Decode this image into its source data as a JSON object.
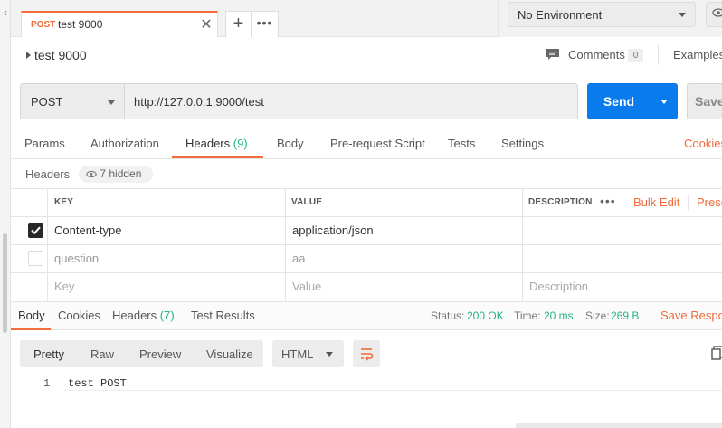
{
  "tabs": {
    "active_method": "POST",
    "active_name": "test 9000",
    "close_glyph": "✕",
    "add_glyph": "+",
    "more_glyph": "•••"
  },
  "environment": {
    "selected": "No Environment"
  },
  "request": {
    "title": "test 9000",
    "comments_label": "Comments",
    "comments_count": "0",
    "examples_label": "Examples",
    "method": "POST",
    "url": "http://127.0.0.1:9000/test",
    "send_label": "Send",
    "save_label": "Save"
  },
  "request_tabs": {
    "params": "Params",
    "authorization": "Authorization",
    "headers": "Headers",
    "headers_count": "(9)",
    "body": "Body",
    "pre_request": "Pre-request Script",
    "tests": "Tests",
    "settings": "Settings",
    "cookies": "Cookies"
  },
  "headers_section": {
    "label": "Headers",
    "hidden_label": "7 hidden",
    "columns": {
      "key": "KEY",
      "value": "VALUE",
      "description": "DESCRIPTION"
    },
    "bulk_edit": "Bulk Edit",
    "presets": "Presets",
    "rows": [
      {
        "key": "Content-type",
        "value": "application/json",
        "enabled": true
      },
      {
        "key": "question",
        "value": "aa",
        "enabled": false
      }
    ],
    "placeholder": {
      "key": "Key",
      "value": "Value",
      "description": "Description"
    }
  },
  "response": {
    "tabs": {
      "body": "Body",
      "cookies": "Cookies",
      "headers": "Headers",
      "headers_count": "(7)",
      "test_results": "Test Results"
    },
    "status_label": "Status:",
    "status_value": "200 OK",
    "time_label": "Time:",
    "time_value": "20 ms",
    "size_label": "Size:",
    "size_value": "269 B",
    "save_response": "Save Response",
    "view_modes": [
      "Pretty",
      "Raw",
      "Preview",
      "Visualize"
    ],
    "format": "HTML",
    "code_lines": [
      {
        "no": "1",
        "text": "test POST"
      }
    ]
  },
  "colors": {
    "accent": "#f26b3a",
    "send_blue": "#097bed",
    "success_green": "#26b47f"
  },
  "icons": [
    "close-icon",
    "plus-icon",
    "more-icon",
    "chevron-down-icon",
    "eye-icon",
    "comment-icon",
    "wrap-lines-icon",
    "copy-icon",
    "check-icon"
  ]
}
